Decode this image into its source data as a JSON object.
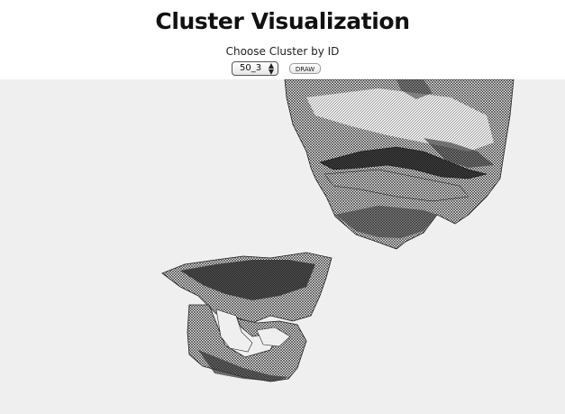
{
  "header": {
    "title": "Cluster Visualization",
    "prompt": "Choose Cluster by ID"
  },
  "controls": {
    "cluster_select": {
      "selected": "50_3"
    },
    "draw_button_label": "DRAW"
  },
  "canvas": {
    "background": "#efefef",
    "stroke_color": "#111111"
  }
}
